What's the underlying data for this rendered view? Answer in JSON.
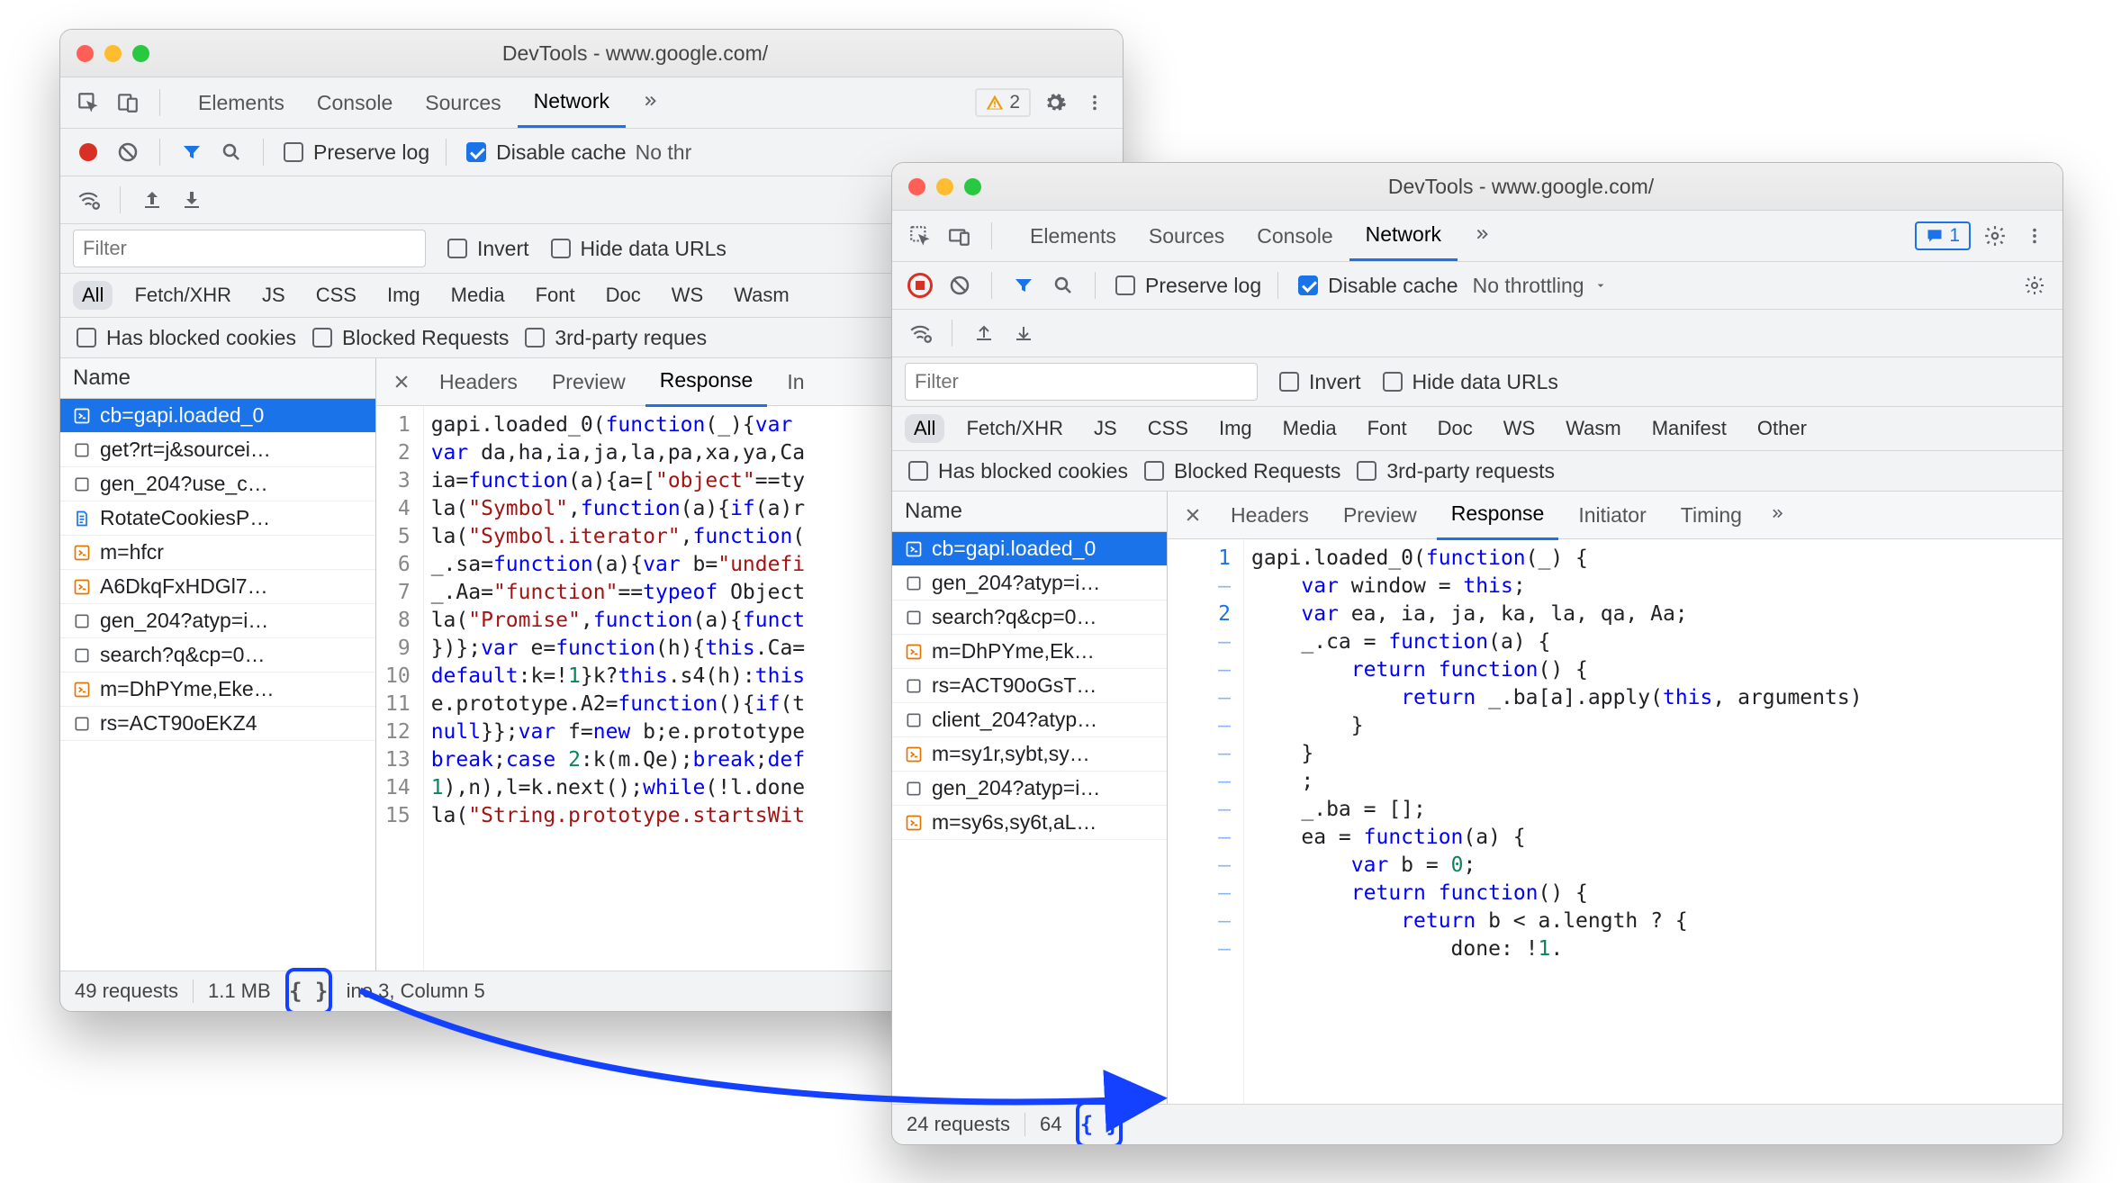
{
  "windows": {
    "left": {
      "title": "DevTools - www.google.com/",
      "tabs": [
        "Elements",
        "Console",
        "Sources",
        "Network"
      ],
      "active_tab": "Network",
      "warn_count": "2",
      "preserve_log": "Preserve log",
      "disable_cache": "Disable cache",
      "throttling_trunc": "No thr",
      "filter_placeholder": "Filter",
      "invert": "Invert",
      "hide_data_urls": "Hide data URLs",
      "type_filters": [
        "All",
        "Fetch/XHR",
        "JS",
        "CSS",
        "Img",
        "Media",
        "Font",
        "Doc",
        "WS",
        "Wasm"
      ],
      "cookie_filters": [
        "Has blocked cookies",
        "Blocked Requests",
        "3rd-party reques"
      ],
      "name_header": "Name",
      "requests": [
        {
          "label": "cb=gapi.loaded_0",
          "icon": "js",
          "sel": true
        },
        {
          "label": "get?rt=j&sourcei…",
          "icon": "doc"
        },
        {
          "label": "gen_204?use_c…",
          "icon": "doc"
        },
        {
          "label": "RotateCookiesP…",
          "icon": "page"
        },
        {
          "label": "m=hfcr",
          "icon": "js-o"
        },
        {
          "label": "A6DkqFxHDGl7…",
          "icon": "js-o"
        },
        {
          "label": "gen_204?atyp=i…",
          "icon": "doc"
        },
        {
          "label": "search?q&cp=0…",
          "icon": "doc"
        },
        {
          "label": "m=DhPYme,Eke…",
          "icon": "js-o"
        },
        {
          "label": "rs=ACT90oEKZ4",
          "icon": "doc"
        }
      ],
      "detail_tabs": [
        "Headers",
        "Preview",
        "Response",
        "In"
      ],
      "detail_active": "Response",
      "status": {
        "reqs": "49 requests",
        "size": "1.1 MB",
        "cursor": "ine 3, Column 5"
      },
      "code_lines": [
        {
          "n": "1",
          "html": "gapi.loaded_0(<span class='tok-kw'>function</span>(_){<span class='tok-kw'>var</span> "
        },
        {
          "n": "2",
          "html": "<span class='tok-kw'>var</span> da,ha,ia,ja,la,pa,xa,ya,Ca"
        },
        {
          "n": "3",
          "html": "ia=<span class='tok-kw'>function</span>(a){a=[<span class='tok-str'>\"object\"</span>==ty"
        },
        {
          "n": "4",
          "html": "la(<span class='tok-str'>\"Symbol\"</span>,<span class='tok-kw'>function</span>(a){<span class='tok-kw'>if</span>(a)r"
        },
        {
          "n": "5",
          "html": "la(<span class='tok-str'>\"Symbol.iterator\"</span>,<span class='tok-kw'>function</span>("
        },
        {
          "n": "6",
          "html": "_.sa=<span class='tok-kw'>function</span>(a){<span class='tok-kw'>var</span> b=<span class='tok-str'>\"undefi</span>"
        },
        {
          "n": "7",
          "html": "_.Aa=<span class='tok-str'>\"function\"</span>==<span class='tok-kw'>typeof</span> Object"
        },
        {
          "n": "8",
          "html": "la(<span class='tok-str'>\"Promise\"</span>,<span class='tok-kw'>function</span>(a){<span class='tok-kw'>funct</span>"
        },
        {
          "n": "9",
          "html": "})};<span class='tok-kw'>var</span> e=<span class='tok-kw'>function</span>(h){<span class='tok-kw'>this</span>.Ca="
        },
        {
          "n": "10",
          "html": "<span class='tok-kw'>default</span>:k=!<span class='tok-num'>1</span>}k?<span class='tok-kw'>this</span>.s4(h):<span class='tok-kw'>this</span>"
        },
        {
          "n": "11",
          "html": "e.prototype.A2=<span class='tok-kw'>function</span>(){<span class='tok-kw'>if</span>(t"
        },
        {
          "n": "12",
          "html": "<span class='tok-kw'>null</span>}};<span class='tok-kw'>var</span> f=<span class='tok-kw'>new</span> b;e.prototype"
        },
        {
          "n": "13",
          "html": "<span class='tok-kw'>break</span>;<span class='tok-kw'>case</span> <span class='tok-num'>2</span>:k(m.Qe);<span class='tok-kw'>break</span>;<span class='tok-kw'>def</span>"
        },
        {
          "n": "14",
          "html": "<span class='tok-num'>1</span>),n),l=k.next();<span class='tok-kw'>while</span>(!l.done"
        },
        {
          "n": "15",
          "html": "la(<span class='tok-str'>\"String.prototype.startsWit</span>"
        }
      ]
    },
    "right": {
      "title": "DevTools - www.google.com/",
      "tabs": [
        "Elements",
        "Sources",
        "Console",
        "Network"
      ],
      "active_tab": "Network",
      "msg_count": "1",
      "preserve_log": "Preserve log",
      "disable_cache": "Disable cache",
      "throttling": "No throttling",
      "filter_placeholder": "Filter",
      "invert": "Invert",
      "hide_data_urls": "Hide data URLs",
      "type_filters": [
        "All",
        "Fetch/XHR",
        "JS",
        "CSS",
        "Img",
        "Media",
        "Font",
        "Doc",
        "WS",
        "Wasm",
        "Manifest",
        "Other"
      ],
      "cookie_filters": [
        "Has blocked cookies",
        "Blocked Requests",
        "3rd-party requests"
      ],
      "name_header": "Name",
      "requests": [
        {
          "label": "cb=gapi.loaded_0",
          "icon": "js",
          "sel": true
        },
        {
          "label": "gen_204?atyp=i…",
          "icon": "doc"
        },
        {
          "label": "search?q&cp=0…",
          "icon": "doc"
        },
        {
          "label": "m=DhPYme,Ek…",
          "icon": "js-o"
        },
        {
          "label": "rs=ACT90oGsT…",
          "icon": "doc"
        },
        {
          "label": "client_204?atyp…",
          "icon": "doc"
        },
        {
          "label": "m=sy1r,sybt,sy…",
          "icon": "js-o"
        },
        {
          "label": "gen_204?atyp=i…",
          "icon": "doc"
        },
        {
          "label": "m=sy6s,sy6t,aL…",
          "icon": "js-o"
        }
      ],
      "detail_tabs": [
        "Headers",
        "Preview",
        "Response",
        "Initiator",
        "Timing"
      ],
      "detail_active": "Response",
      "status": {
        "reqs": "24 requests",
        "size": "64"
      },
      "code_lines": [
        {
          "n": "1",
          "cls": "blue",
          "html": "gapi.loaded_0(<span class='tok-kw'>function</span>(_) {"
        },
        {
          "n": "–",
          "cls": "dash",
          "html": "    <span class='tok-kw'>var</span> window = <span class='tok-kw'>this</span>;"
        },
        {
          "n": "2",
          "cls": "blue",
          "html": "    <span class='tok-kw'>var</span> ea, ia, ja, ka, la, qa, Aa;"
        },
        {
          "n": "–",
          "cls": "dash",
          "html": "    _.ca = <span class='tok-kw'>function</span>(a) {"
        },
        {
          "n": "–",
          "cls": "dash",
          "html": "        <span class='tok-kw'>return</span> <span class='tok-kw'>function</span>() {"
        },
        {
          "n": "–",
          "cls": "dash",
          "html": "            <span class='tok-kw'>return</span> _.ba[a].apply(<span class='tok-kw'>this</span>, arguments)"
        },
        {
          "n": "–",
          "cls": "dash",
          "html": "        }"
        },
        {
          "n": "–",
          "cls": "dash",
          "html": "    }"
        },
        {
          "n": "–",
          "cls": "dash",
          "html": "    ;"
        },
        {
          "n": "–",
          "cls": "dash",
          "html": "    _.ba = [];"
        },
        {
          "n": "–",
          "cls": "dash",
          "html": "    ea = <span class='tok-kw'>function</span>(a) {"
        },
        {
          "n": "–",
          "cls": "dash",
          "html": "        <span class='tok-kw'>var</span> b = <span class='tok-num'>0</span>;"
        },
        {
          "n": "–",
          "cls": "dash",
          "html": "        <span class='tok-kw'>return</span> <span class='tok-kw'>function</span>() {"
        },
        {
          "n": "–",
          "cls": "dash",
          "html": "            <span class='tok-kw'>return</span> b &lt; a.length ? {"
        },
        {
          "n": "–",
          "cls": "dash",
          "html": "                done: !<span class='tok-num'>1</span>."
        }
      ]
    }
  }
}
